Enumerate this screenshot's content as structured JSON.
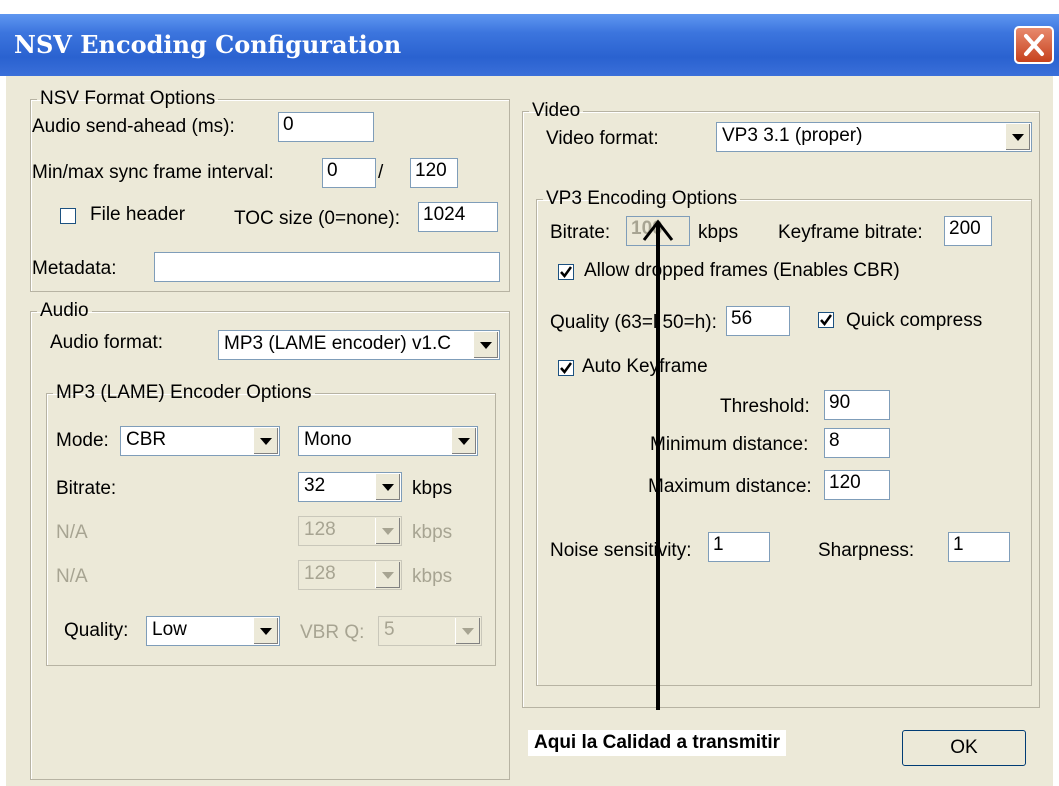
{
  "window": {
    "title": "NSV Encoding Configuration"
  },
  "nsv": {
    "legend": "NSV Format Options",
    "audio_send_ahead_label": "Audio send-ahead (ms):",
    "audio_send_ahead_value": "0",
    "sync_label": "Min/max sync frame interval:",
    "sync_min": "0",
    "sync_sep": "/",
    "sync_max": "120",
    "file_header_label": "File header",
    "file_header_checked": false,
    "toc_label": "TOC size (0=none):",
    "toc_value": "1024",
    "metadata_label": "Metadata:",
    "metadata_value": ""
  },
  "audio": {
    "legend": "Audio",
    "format_label": "Audio format:",
    "format_value": "MP3 (LAME encoder) v1.C"
  },
  "mp3": {
    "legend": "MP3 (LAME) Encoder Options",
    "mode_label": "Mode:",
    "mode_value": "CBR",
    "channel_value": "Mono",
    "bitrate_label": "Bitrate:",
    "bitrate_value": "32",
    "kbps": "kbps",
    "na1_label": "N/A",
    "na1_value": "128",
    "na2_label": "N/A",
    "na2_value": "128",
    "quality_label": "Quality:",
    "quality_value": "Low",
    "vbrq_label": "VBR Q:",
    "vbrq_value": "5"
  },
  "video": {
    "legend": "Video",
    "format_label": "Video format:",
    "format_value": "VP3 3.1 (proper)"
  },
  "vp3": {
    "legend": "VP3 Encoding Options",
    "bitrate_label": "Bitrate:",
    "bitrate_value": "100",
    "kbps": "kbps",
    "kf_bitrate_label": "Keyframe bitrate:",
    "kf_bitrate_value": "200",
    "allow_dropped_label": "Allow dropped frames (Enables CBR)",
    "allow_dropped_checked": true,
    "quality_label": "Quality (63=l 50=h):",
    "quality_value": "56",
    "quick_compress_label": "Quick compress",
    "quick_compress_checked": true,
    "auto_keyframe_label": "Auto Keyframe",
    "auto_keyframe_checked": true,
    "threshold_label": "Threshold:",
    "threshold_value": "90",
    "min_dist_label": "Minimum distance:",
    "min_dist_value": "8",
    "max_dist_label": "Maximum distance:",
    "max_dist_value": "120",
    "noise_label": "Noise sensitivity:",
    "noise_value": "1",
    "sharpness_label": "Sharpness:",
    "sharpness_value": "1"
  },
  "annotation": {
    "text": "Aqui la Calidad a transmitir"
  },
  "buttons": {
    "ok": "OK"
  },
  "colors": {
    "titlebar": "#2a62d0",
    "face": "#ece9d8",
    "close": "#c7421e"
  },
  "icons": {
    "close": "close-icon",
    "dropdown": "chevron-down-icon",
    "check": "check-icon",
    "arrow": "arrow-up-icon"
  }
}
